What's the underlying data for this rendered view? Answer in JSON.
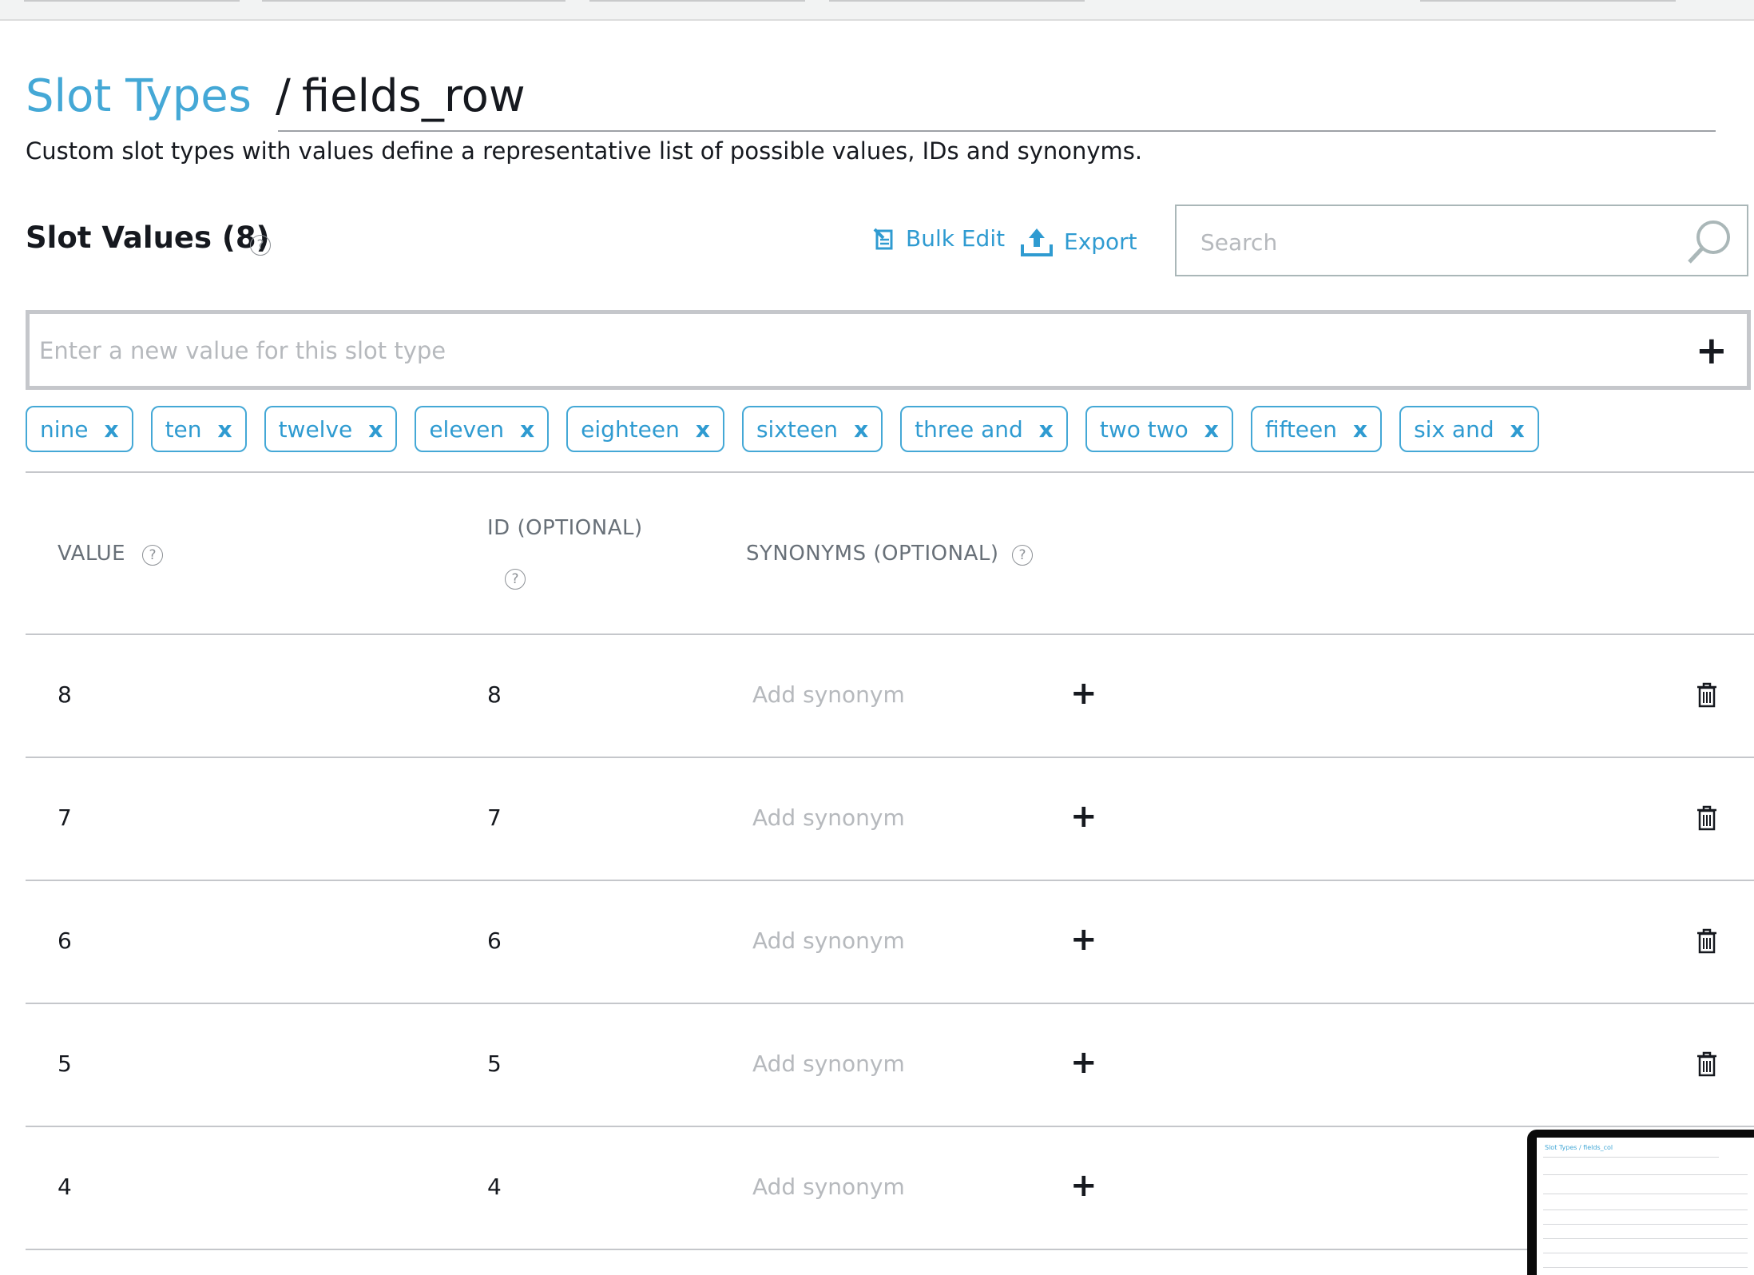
{
  "breadcrumb": {
    "parent": "Slot Types",
    "separator": "/",
    "current": "fields_row"
  },
  "description": "Custom slot types with values define a representative list of possible values, IDs and synonyms.",
  "slot_values": {
    "title": "Slot Values (8)",
    "bulk_edit_label": "Bulk Edit",
    "export_label": "Export",
    "search_placeholder": "Search",
    "new_value_placeholder": "Enter a new value for this slot type"
  },
  "chips": [
    {
      "label": "nine",
      "remove": "x"
    },
    {
      "label": "ten",
      "remove": "x"
    },
    {
      "label": "twelve",
      "remove": "x"
    },
    {
      "label": "eleven",
      "remove": "x"
    },
    {
      "label": "eighteen",
      "remove": "x"
    },
    {
      "label": "sixteen",
      "remove": "x"
    },
    {
      "label": "three and",
      "remove": "x"
    },
    {
      "label": "two two",
      "remove": "x"
    },
    {
      "label": "fifteen",
      "remove": "x"
    },
    {
      "label": "six and",
      "remove": "x"
    }
  ],
  "table": {
    "columns": {
      "value": "VALUE",
      "id": "ID (OPTIONAL)",
      "synonyms": "SYNONYMS (OPTIONAL)"
    },
    "rows": [
      {
        "value": "8",
        "id": "8",
        "synonym_placeholder": "Add synonym"
      },
      {
        "value": "7",
        "id": "7",
        "synonym_placeholder": "Add synonym"
      },
      {
        "value": "6",
        "id": "6",
        "synonym_placeholder": "Add synonym"
      },
      {
        "value": "5",
        "id": "5",
        "synonym_placeholder": "Add synonym"
      },
      {
        "value": "4",
        "id": "4",
        "synonym_placeholder": "Add synonym"
      }
    ]
  },
  "thumbnail": {
    "title": "Slot Types / fields_col"
  },
  "icons": {
    "help": "?",
    "add": "+",
    "bulk_edit": "bulk-edit-icon",
    "export": "export-icon",
    "search": "search-icon",
    "trash": "trash-icon"
  },
  "colors": {
    "accent": "#44a8d6",
    "text": "#16191f",
    "muted": "#687078",
    "placeholder": "#b6b9bd"
  }
}
